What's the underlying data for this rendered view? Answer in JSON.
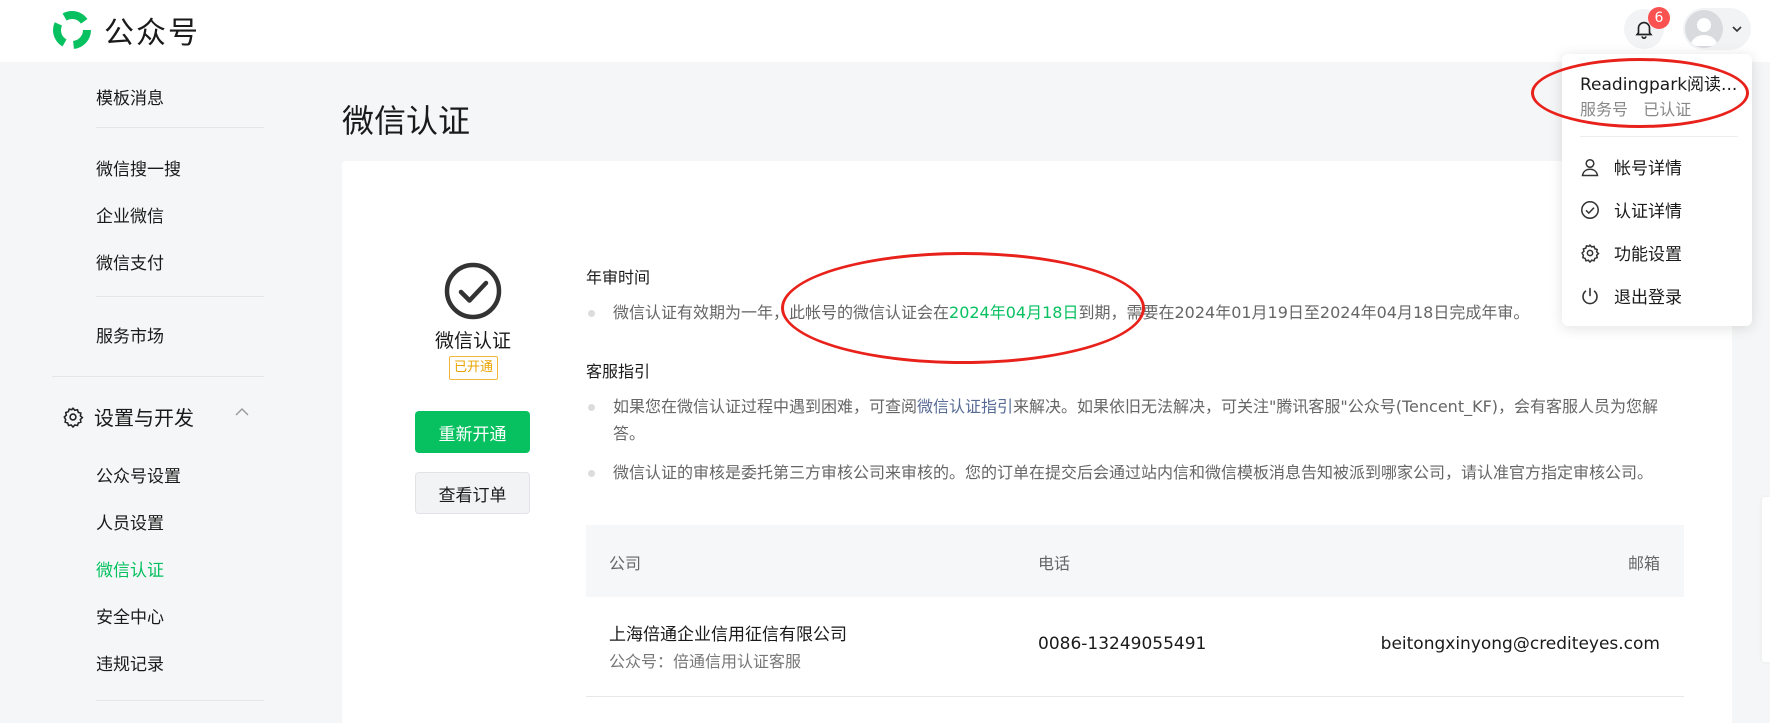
{
  "header": {
    "app_title": "公众号",
    "notification_count": "6",
    "logo_color": "#07c160"
  },
  "sidebar": {
    "items_top": [
      {
        "label": "模板消息"
      },
      {
        "label": "微信搜一搜"
      },
      {
        "label": "企业微信"
      },
      {
        "label": "微信支付"
      },
      {
        "label": "服务市场"
      }
    ],
    "group": {
      "label": "设置与开发",
      "icon": "gear-icon",
      "expanded": true
    },
    "group_items": [
      {
        "label": "公众号设置"
      },
      {
        "label": "人员设置"
      },
      {
        "label": "微信认证",
        "active": true
      },
      {
        "label": "安全中心"
      },
      {
        "label": "违规记录"
      }
    ]
  },
  "main": {
    "page_title": "微信认证",
    "status": {
      "label": "微信认证",
      "badge": "已开通",
      "renew_button": "重新开通",
      "orders_button": "查看订单"
    },
    "annual_review": {
      "title": "年审时间",
      "text_before": "微信认证有效期为一年，此帐号的微信认证会在",
      "expiry_date": "2024年04月18日",
      "text_after": "到期，需要在2024年01月19日至2024年04月18日完成年审。"
    },
    "guide": {
      "title": "客服指引",
      "item1_before": "如果您在微信认证过程中遇到困难，可查阅",
      "item1_link": "微信认证指引",
      "item1_after": "来解决。如果依旧无法解决，可关注\"腾讯客服\"公众号(Tencent_KF)，会有客服人员为您解答。",
      "item2": "微信认证的审核是委托第三方审核公司来审核的。您的订单在提交后会通过站内信和微信模板消息告知被派到哪家公司，请认准官方指定审核公司。"
    },
    "table": {
      "headers": [
        "公司",
        "电话",
        "邮箱"
      ],
      "rows": [
        {
          "company": "上海倍通企业信用征信有限公司",
          "account": "公众号：倍通信用认证客服",
          "phone": "0086-13249055491",
          "email": "beitongxinyong@crediteyes.com"
        }
      ]
    }
  },
  "account_menu": {
    "name": "Readingpark阅读...",
    "type": "服务号",
    "verified": "已认证",
    "items": [
      {
        "label": "帐号详情",
        "icon": "user-icon"
      },
      {
        "label": "认证详情",
        "icon": "check-circle-icon"
      },
      {
        "label": "功能设置",
        "icon": "gear-icon"
      },
      {
        "label": "退出登录",
        "icon": "power-icon"
      }
    ]
  },
  "colors": {
    "accent": "#07c160",
    "badge_red": "#fa5151",
    "annotation_red": "#e8211b",
    "link": "#576b95",
    "badge_orange": "#e8a400"
  }
}
